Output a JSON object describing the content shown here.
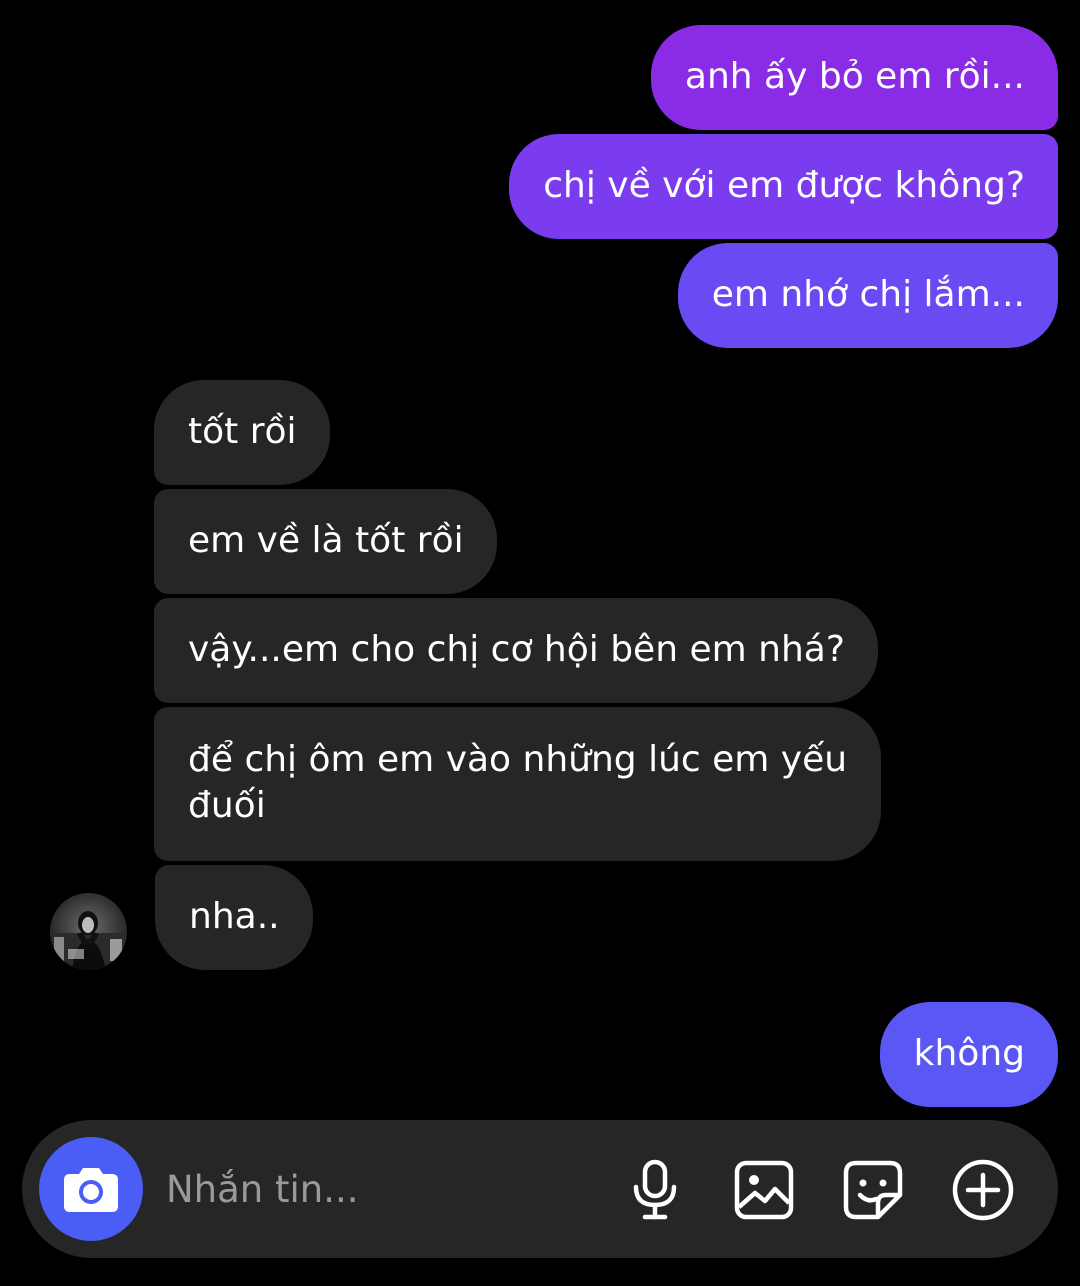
{
  "colors": {
    "background": "#000000",
    "sent_gradient_top": "#8a2be6",
    "sent_gradient_mid": "#7b3cf0",
    "sent_gradient_bottom": "#5b57f4",
    "received_bubble": "#262626",
    "composer": "#262626",
    "camera_button": "#4a5df5",
    "placeholder": "#9a9a9a"
  },
  "messages": [
    {
      "direction": "sent",
      "text": "anh ấy bỏ em rồi..."
    },
    {
      "direction": "sent",
      "text": "chị về với em được không?"
    },
    {
      "direction": "sent",
      "text": "em nhớ chị lắm..."
    },
    {
      "direction": "received",
      "text": "tốt rồi"
    },
    {
      "direction": "received",
      "text": "em về là tốt rồi"
    },
    {
      "direction": "received",
      "text": "vậy...em cho chị cơ hội bên em nhá?"
    },
    {
      "direction": "received",
      "text": "để chị ôm em vào những lúc em yếu đuối"
    },
    {
      "direction": "received",
      "text": "nha.."
    },
    {
      "direction": "sent",
      "text": "không"
    }
  ],
  "composer": {
    "placeholder": "Nhắn tin...",
    "camera_icon": "camera-icon",
    "mic_icon": "microphone-icon",
    "gallery_icon": "image-icon",
    "sticker_icon": "sticker-icon",
    "add_icon": "plus-circle-icon"
  }
}
